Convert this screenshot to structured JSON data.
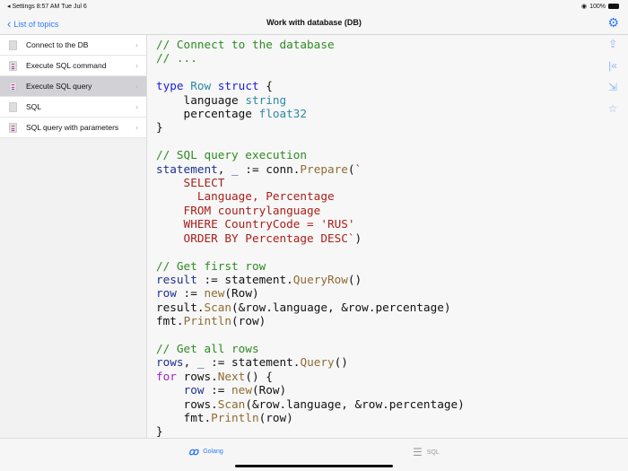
{
  "status": {
    "left": "◂ Settings   8:57 AM   Tue Jul 6",
    "battery": "100%"
  },
  "nav": {
    "back": "List of topics",
    "title": "Work with database (DB)",
    "settings_icon": "gear-icon"
  },
  "sidebar": {
    "items": [
      {
        "label": "Connect to the DB",
        "selected": false
      },
      {
        "label": "Execute SQL command",
        "selected": false
      },
      {
        "label": "Execute SQL query",
        "selected": true
      },
      {
        "label": "SQL",
        "selected": false
      },
      {
        "label": "SQL query with parameters",
        "selected": false
      }
    ]
  },
  "code": [
    [
      [
        "c",
        "// Connect to the database"
      ]
    ],
    [
      [
        "c",
        "// ..."
      ]
    ],
    [],
    [
      [
        "k",
        "type "
      ],
      [
        "t",
        "Row "
      ],
      [
        "k",
        "struct "
      ],
      [
        "p",
        "{"
      ]
    ],
    [
      [
        "p",
        "    language "
      ],
      [
        "t",
        "string"
      ]
    ],
    [
      [
        "p",
        "    percentage "
      ],
      [
        "t",
        "float32"
      ]
    ],
    [
      [
        "p",
        "}"
      ]
    ],
    [],
    [
      [
        "c",
        "// SQL query execution"
      ]
    ],
    [
      [
        "v",
        "statement"
      ],
      [
        "p",
        ", "
      ],
      [
        "v",
        "_"
      ],
      [
        "p",
        " := conn."
      ],
      [
        "fn",
        "Prepare"
      ],
      [
        "p",
        "("
      ],
      [
        "s",
        "`"
      ]
    ],
    [
      [
        "s",
        "    SELECT"
      ]
    ],
    [
      [
        "s",
        "      Language, Percentage"
      ]
    ],
    [
      [
        "s",
        "    FROM countrylanguage"
      ]
    ],
    [
      [
        "s",
        "    WHERE CountryCode = 'RUS'"
      ]
    ],
    [
      [
        "s",
        "    ORDER BY Percentage DESC`"
      ],
      [
        "p",
        ")"
      ]
    ],
    [],
    [
      [
        "c",
        "// Get first row"
      ]
    ],
    [
      [
        "v",
        "result"
      ],
      [
        "p",
        " := statement."
      ],
      [
        "fn",
        "QueryRow"
      ],
      [
        "p",
        "()"
      ]
    ],
    [
      [
        "v",
        "row"
      ],
      [
        "p",
        " := "
      ],
      [
        "fn",
        "new"
      ],
      [
        "p",
        "(Row)"
      ]
    ],
    [
      [
        "p",
        "result."
      ],
      [
        "fn",
        "Scan"
      ],
      [
        "p",
        "(&row.language, &row.percentage)"
      ]
    ],
    [
      [
        "p",
        "fmt."
      ],
      [
        "fn",
        "Println"
      ],
      [
        "p",
        "(row)"
      ]
    ],
    [],
    [
      [
        "c",
        "// Get all rows"
      ]
    ],
    [
      [
        "v",
        "rows"
      ],
      [
        "p",
        ", "
      ],
      [
        "v",
        "_"
      ],
      [
        "p",
        " := statement."
      ],
      [
        "fn",
        "Query"
      ],
      [
        "p",
        "()"
      ]
    ],
    [
      [
        "f",
        "for "
      ],
      [
        "p",
        "rows."
      ],
      [
        "fn",
        "Next"
      ],
      [
        "p",
        "() {"
      ]
    ],
    [
      [
        "p",
        "    "
      ],
      [
        "v",
        "row"
      ],
      [
        "p",
        " := "
      ],
      [
        "fn",
        "new"
      ],
      [
        "p",
        "(Row)"
      ]
    ],
    [
      [
        "p",
        "    rows."
      ],
      [
        "fn",
        "Scan"
      ],
      [
        "p",
        "(&row.language, &row.percentage)"
      ]
    ],
    [
      [
        "p",
        "    fmt."
      ],
      [
        "fn",
        "Println"
      ],
      [
        "p",
        "(row)"
      ]
    ],
    [
      [
        "p",
        "}"
      ]
    ]
  ],
  "tabs": {
    "golang": "Golang",
    "sql": "SQL"
  },
  "colors": {
    "accent": "#2f7cf6",
    "selected": "#d1d1d6"
  }
}
